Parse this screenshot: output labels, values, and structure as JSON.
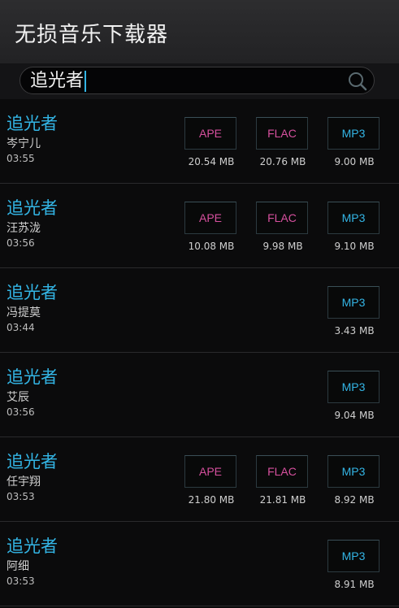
{
  "app": {
    "title": "无损音乐下载器"
  },
  "search": {
    "query": "追光者",
    "icon": "search-icon"
  },
  "colors": {
    "accent": "#33b5e5",
    "lossless_label": "#d6509e"
  },
  "results": [
    {
      "title": "追光者",
      "artist": "岑宁儿",
      "duration": "03:55",
      "ape": {
        "label": "APE",
        "size": "20.54 MB"
      },
      "flac": {
        "label": "FLAC",
        "size": "20.76 MB"
      },
      "mp3": {
        "label": "MP3",
        "size": "9.00 MB"
      }
    },
    {
      "title": "追光者",
      "artist": "汪苏泷",
      "duration": "03:56",
      "ape": {
        "label": "APE",
        "size": "10.08 MB"
      },
      "flac": {
        "label": "FLAC",
        "size": "9.98 MB"
      },
      "mp3": {
        "label": "MP3",
        "size": "9.10 MB"
      }
    },
    {
      "title": "追光者",
      "artist": "冯提莫",
      "duration": "03:44",
      "mp3": {
        "label": "MP3",
        "size": "3.43 MB"
      }
    },
    {
      "title": "追光者",
      "artist": "艾辰",
      "duration": "03:56",
      "mp3": {
        "label": "MP3",
        "size": "9.04 MB"
      }
    },
    {
      "title": "追光者",
      "artist": "任宇翔",
      "duration": "03:53",
      "ape": {
        "label": "APE",
        "size": "21.80 MB"
      },
      "flac": {
        "label": "FLAC",
        "size": "21.81 MB"
      },
      "mp3": {
        "label": "MP3",
        "size": "8.92 MB"
      }
    },
    {
      "title": "追光者",
      "artist": "阿细",
      "duration": "03:53",
      "mp3": {
        "label": "MP3",
        "size": "8.91 MB"
      }
    }
  ]
}
